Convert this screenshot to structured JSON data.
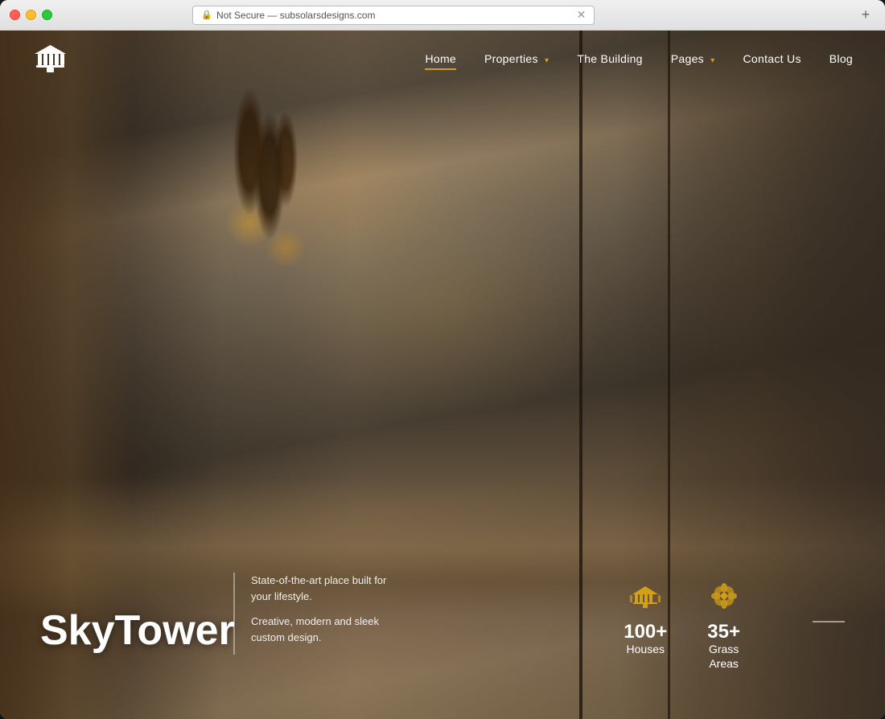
{
  "browser": {
    "security_label": "Not Secure",
    "url": "subsolarsdesigns.com",
    "tab_plus_label": "+"
  },
  "nav": {
    "items": [
      {
        "id": "home",
        "label": "Home",
        "active": true,
        "has_dropdown": false
      },
      {
        "id": "properties",
        "label": "Properties",
        "active": false,
        "has_dropdown": true
      },
      {
        "id": "the-building",
        "label": "The Building",
        "active": false,
        "has_dropdown": false
      },
      {
        "id": "pages",
        "label": "Pages",
        "active": false,
        "has_dropdown": true
      },
      {
        "id": "contact",
        "label": "Contact Us",
        "active": false,
        "has_dropdown": false
      },
      {
        "id": "blog",
        "label": "Blog",
        "active": false,
        "has_dropdown": false
      }
    ]
  },
  "hero": {
    "title": "SkyTower",
    "description_line1": "State-of-the-art place built for your lifestyle.",
    "description_line2": "Creative, modern and sleek custom design."
  },
  "stats": [
    {
      "id": "houses",
      "value": "100+",
      "label": "Houses",
      "icon": "building-icon"
    },
    {
      "id": "grass",
      "value": "35+",
      "label": "Grass\nAreas",
      "icon": "flower-icon"
    }
  ],
  "colors": {
    "accent": "#D4A017",
    "text_primary": "#ffffff",
    "nav_underline": "#D4A017"
  }
}
